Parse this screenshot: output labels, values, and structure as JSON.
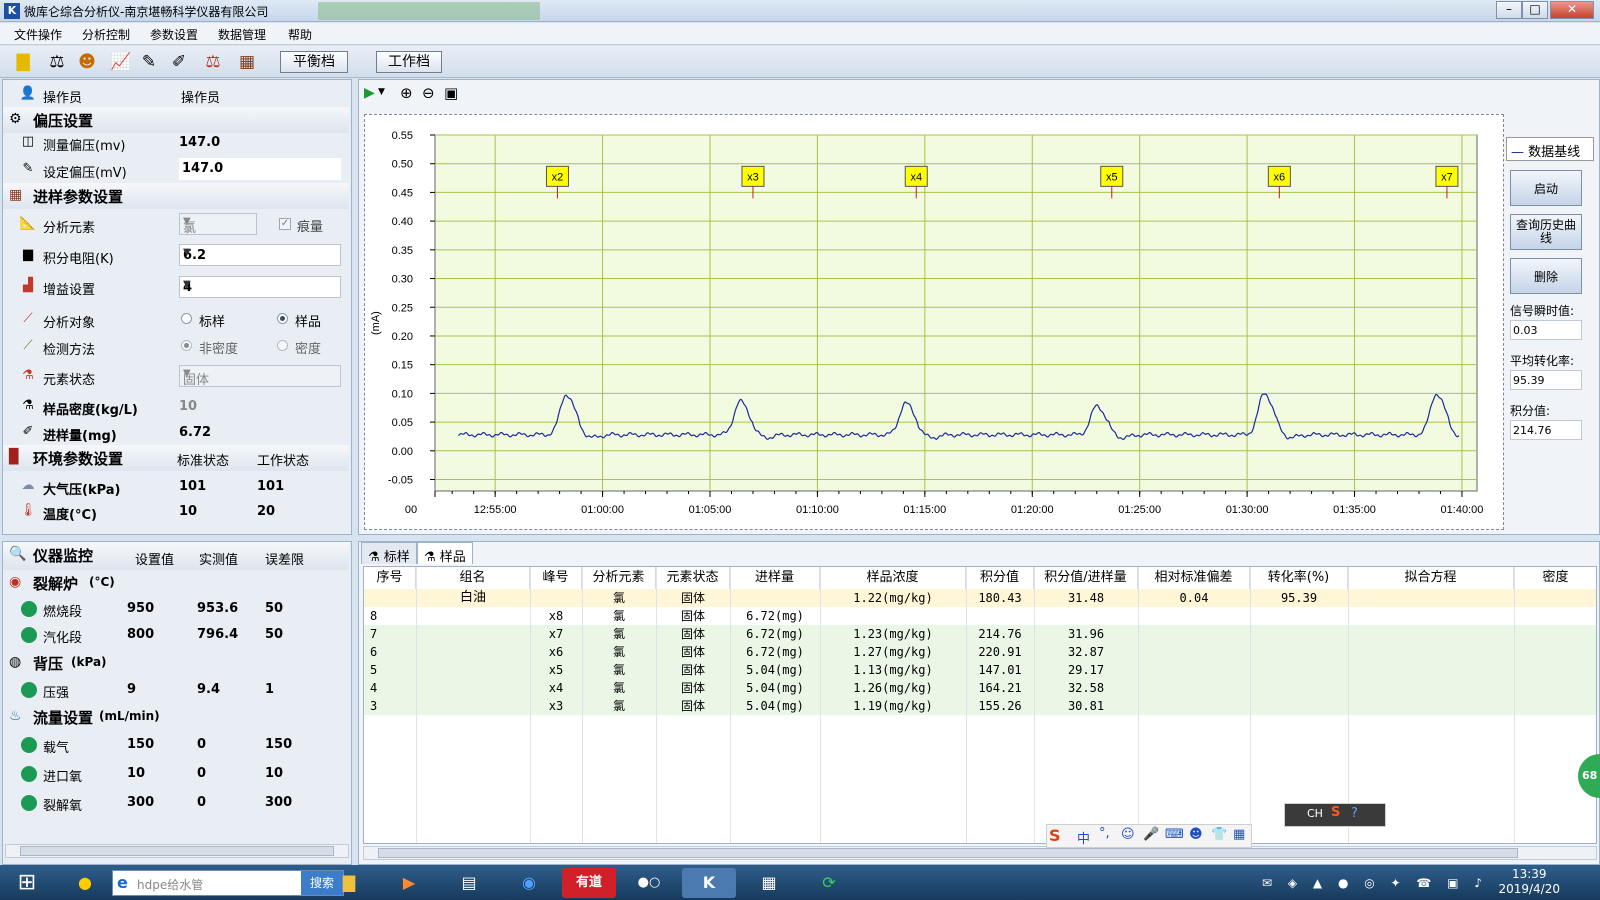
{
  "window": {
    "title": "微库仑综合分析仪-南京堪畅科学仪器有限公司",
    "controls": [
      "–",
      "□",
      "✕"
    ]
  },
  "menu": [
    "文件操作",
    "分析控制",
    "参数设置",
    "数据管理",
    "帮助"
  ],
  "toolbar": {
    "icons": [
      "file-icon",
      "balance-icon",
      "user-icon",
      "chart-icon",
      "pipette-icon",
      "syringe-icon",
      "scale-chart-icon",
      "calculator-icon"
    ],
    "balance_label": "平衡档",
    "work_label": "工作档"
  },
  "operator": {
    "label": "操作员",
    "value": "操作员"
  },
  "bias": {
    "title": "偏压设置",
    "measure_label": "测量偏压(mv)",
    "measure_value": "147.0",
    "set_label": "设定偏压(mV)",
    "set_value": "147.0"
  },
  "sampling": {
    "title": "进样参数设置",
    "element_label": "分析元素",
    "element_value": "氯",
    "trace_label": "痕量",
    "resistor_label": "积分电阻(K)",
    "resistor_value": "6.2",
    "gain_label": "增益设置",
    "gain_value": "4",
    "target_label": "分析对象",
    "target_opt1": "标样",
    "target_opt2": "样品",
    "method_label": "检测方法",
    "method_opt1": "非密度",
    "method_opt2": "密度",
    "state_label": "元素状态",
    "state_value": "固体",
    "density_label": "样品密度(kg/L)",
    "density_value": "10",
    "amount_label": "进样量(mg)",
    "amount_value": "6.72"
  },
  "env": {
    "title": "环境参数设置",
    "std_label": "标准状态",
    "work_label": "工作状态",
    "pressure_label": "大气压(kPa)",
    "pressure_std": "101",
    "pressure_work": "101",
    "temp_label": "温度(°C)",
    "temp_std": "10",
    "temp_work": "20"
  },
  "monitor": {
    "title": "仪器监控",
    "col_set": "设置值",
    "col_measured": "实测值",
    "col_error": "误差限",
    "furnace_title": "裂解炉",
    "furnace_unit": "(°C)",
    "burn_label": "燃烧段",
    "burn_set": "950",
    "burn_meas": "953.6",
    "burn_err": "50",
    "vapor_label": "汽化段",
    "vapor_set": "800",
    "vapor_meas": "796.4",
    "vapor_err": "50",
    "back_title": "背压",
    "back_unit": "(kPa)",
    "press_label": "压强",
    "press_set": "9",
    "press_meas": "9.4",
    "press_err": "1",
    "flow_title": "流量设置",
    "flow_unit": "(mL/min)",
    "carrier_label": "载气",
    "carrier_set": "150",
    "carrier_meas": "0",
    "carrier_err": "150",
    "inlet_label": "进口氧",
    "inlet_set": "10",
    "inlet_meas": "0",
    "inlet_err": "10",
    "crack_label": "裂解氧",
    "crack_set": "300",
    "crack_meas": "0",
    "crack_err": "300"
  },
  "right": {
    "legend": "数据基线",
    "start_btn": "启动",
    "history_btn": "查询历史曲线",
    "delete_btn": "删除",
    "signal_label": "信号瞬时值:",
    "signal_value": "0.03",
    "conv_label": "平均转化率:",
    "conv_value": "95.39",
    "integ_label": "积分值:",
    "integ_value": "214.76"
  },
  "chart_data": {
    "type": "line",
    "ylabel": "(mA)",
    "ylim": [
      -0.07,
      0.55
    ],
    "yticks": [
      "0.55",
      "0.50",
      "0.45",
      "0.40",
      "0.35",
      "0.30",
      "0.25",
      "0.20",
      "0.15",
      "0.10",
      "0.05",
      "0.00",
      "-0.05"
    ],
    "xlim_minutes": [
      52.2,
      100.7
    ],
    "xticks": [
      {
        "t": 52.2,
        "label": "00"
      },
      {
        "t": 55,
        "label": "12:55:00"
      },
      {
        "t": 60,
        "label": "01:00:00"
      },
      {
        "t": 65,
        "label": "01:05:00"
      },
      {
        "t": 70,
        "label": "01:10:00"
      },
      {
        "t": 75,
        "label": "01:15:00"
      },
      {
        "t": 80,
        "label": "01:20:00"
      },
      {
        "t": 85,
        "label": "01:25:00"
      },
      {
        "t": 90,
        "label": "01:30:00"
      },
      {
        "t": 95,
        "label": "01:35:00"
      },
      {
        "t": 100,
        "label": "01:40:00"
      }
    ],
    "baseline": 0.028,
    "x_start": 53.3,
    "x_end": 99.9,
    "peaks": [
      {
        "t": 58.3,
        "h": 0.098
      },
      {
        "t": 66.4,
        "h": 0.086
      },
      {
        "t": 74.1,
        "h": 0.083
      },
      {
        "t": 83.0,
        "h": 0.078
      },
      {
        "t": 90.8,
        "h": 0.1
      },
      {
        "t": 98.8,
        "h": 0.099
      }
    ],
    "markers": [
      {
        "t": 57.9,
        "label": "x2"
      },
      {
        "t": 67.0,
        "label": "x3"
      },
      {
        "t": 74.6,
        "label": "x4"
      },
      {
        "t": 83.7,
        "label": "x5"
      },
      {
        "t": 91.5,
        "label": "x6"
      },
      {
        "t": 99.3,
        "label": "x7"
      }
    ],
    "marker_y": 0.478
  },
  "table": {
    "tabs": [
      "标样",
      "样品"
    ],
    "headers": [
      "序号",
      "组名",
      "峰号",
      "分析元素",
      "元素状态",
      "进样量",
      "样品浓度",
      "积分值",
      "积分值/进样量",
      "相对标准偏差",
      "转化率(%)",
      "拟合方程",
      "密度"
    ],
    "rows": [
      [
        "",
        "白油",
        "",
        "氯",
        "固体",
        "",
        "1.22(mg/kg)",
        "180.43",
        "31.48",
        "0.04",
        "95.39",
        "",
        ""
      ],
      [
        "8",
        "",
        "x8",
        "氯",
        "固体",
        "6.72(mg)",
        "",
        "",
        "",
        "",
        "",
        "",
        ""
      ],
      [
        "7",
        "",
        "x7",
        "氯",
        "固体",
        "6.72(mg)",
        "1.23(mg/kg)",
        "214.76",
        "31.96",
        "",
        "",
        "",
        ""
      ],
      [
        "6",
        "",
        "x6",
        "氯",
        "固体",
        "6.72(mg)",
        "1.27(mg/kg)",
        "220.91",
        "32.87",
        "",
        "",
        "",
        ""
      ],
      [
        "5",
        "",
        "x5",
        "氯",
        "固体",
        "5.04(mg)",
        "1.13(mg/kg)",
        "147.01",
        "29.17",
        "",
        "",
        "",
        ""
      ],
      [
        "4",
        "",
        "x4",
        "氯",
        "固体",
        "5.04(mg)",
        "1.26(mg/kg)",
        "164.21",
        "32.58",
        "",
        "",
        "",
        ""
      ],
      [
        "3",
        "",
        "x3",
        "氯",
        "固体",
        "5.04(mg)",
        "1.19(mg/kg)",
        "155.26",
        "30.81",
        "",
        "",
        "",
        ""
      ]
    ]
  },
  "ime": {
    "label": "CH",
    "zh": "中",
    "punct": "°,"
  },
  "taskbar": {
    "search_placeholder": "hdpe给水管",
    "search_btn": "搜索",
    "youdao": "有道",
    "time": "13:39",
    "date": "2019/4/20",
    "badge": "68"
  },
  "colors": {
    "accent": "#1f3f9a",
    "chart_bg": "#f2fbe0",
    "grid": "#a9c24a",
    "line": "#1a2a9c",
    "marker": "#ffff00",
    "highlight_row": "#fff6d8",
    "green_row": "#eaf6e6"
  }
}
